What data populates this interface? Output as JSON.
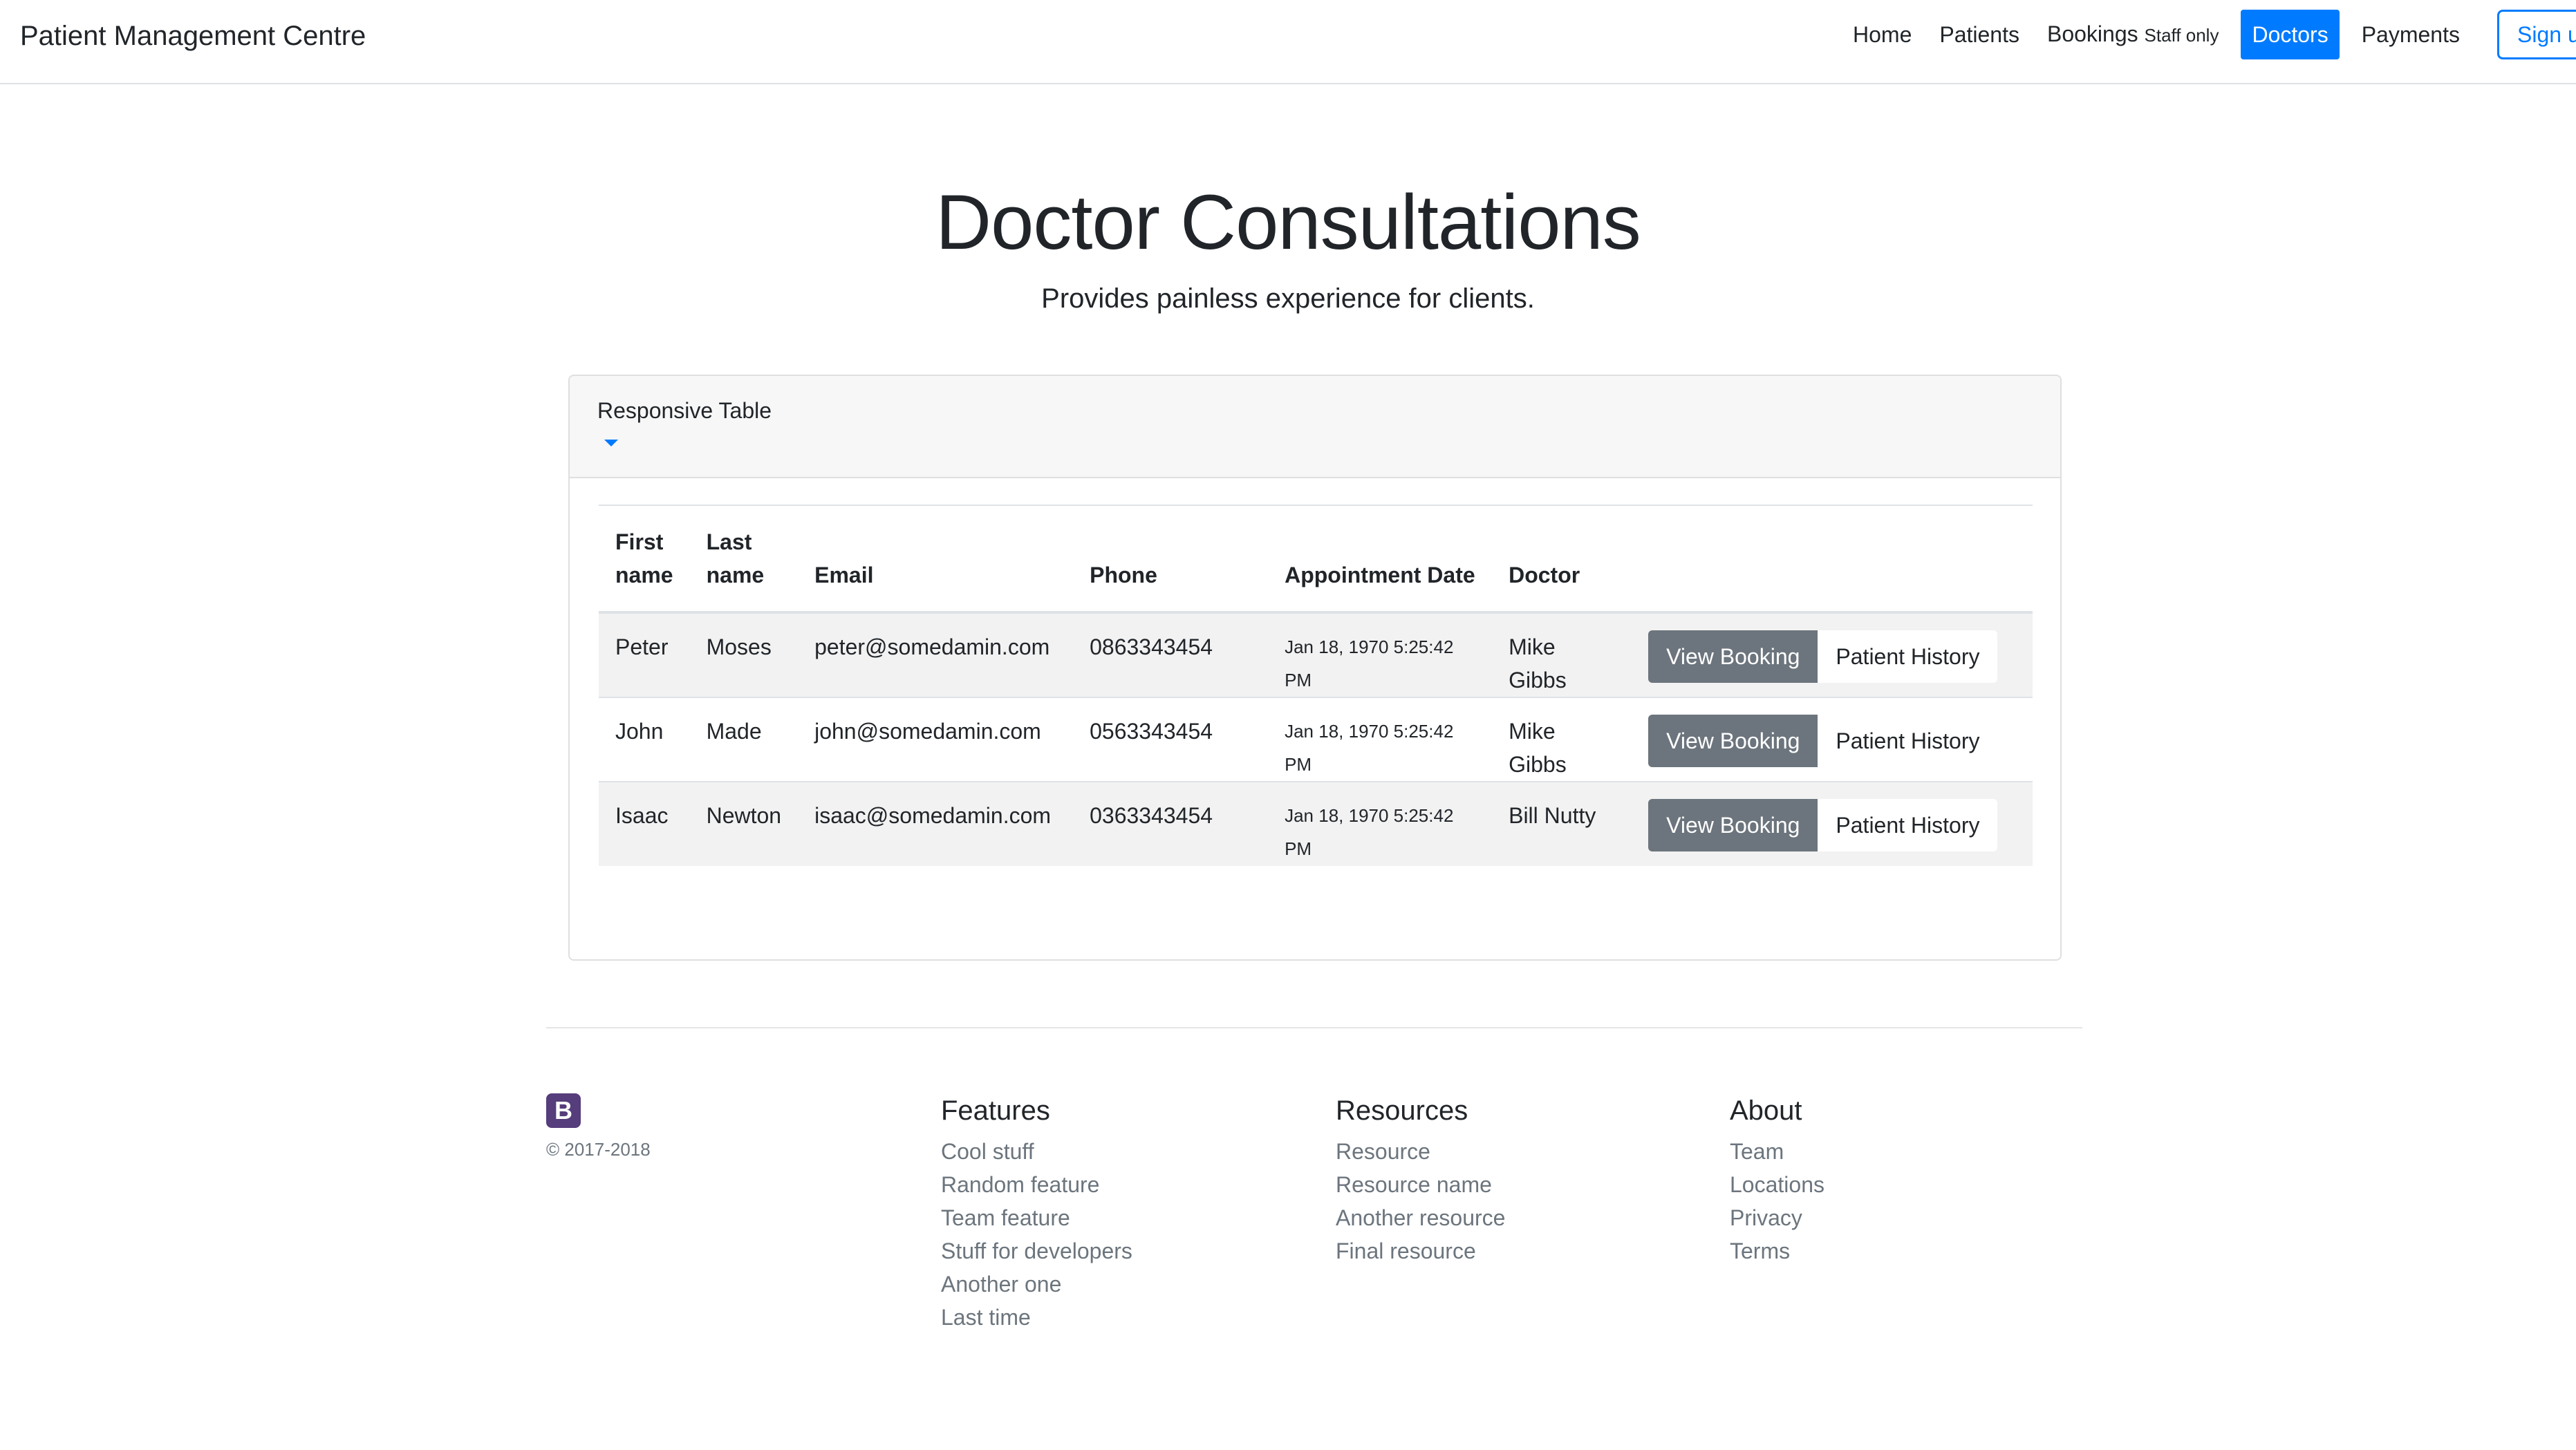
{
  "navbar": {
    "brand": "Patient Management Centre",
    "links": [
      {
        "label": "Home"
      },
      {
        "label": "Patients"
      },
      {
        "label": "Bookings",
        "note": "Staff only"
      },
      {
        "label": "Doctors",
        "active": true
      },
      {
        "label": "Payments"
      }
    ],
    "signup_label": "Sign u"
  },
  "hero": {
    "title": "Doctor Consultations",
    "subtitle": "Provides painless experience for clients."
  },
  "card": {
    "title": "Responsive Table",
    "caret_icon": "caret-down-icon"
  },
  "table": {
    "headers": {
      "first": "First name",
      "last": "Last name",
      "email": "Email",
      "phone": "Phone",
      "date": "Appointment Date",
      "doctor": "Doctor"
    },
    "rows": [
      {
        "first": "Peter",
        "last": "Moses",
        "email": "peter@somedamin.com",
        "phone": "0863343454",
        "date": "Jan 18, 1970 5:25:42 PM",
        "doctor": "Mike Gibbs",
        "view": "View Booking",
        "history": "Patient History"
      },
      {
        "first": "John",
        "last": "Made",
        "email": "john@somedamin.com",
        "phone": "0563343454",
        "date": "Jan 18, 1970 5:25:42 PM",
        "doctor": "Mike Gibbs",
        "view": "View Booking",
        "history": "Patient History"
      },
      {
        "first": "Isaac",
        "last": "Newton",
        "email": "isaac@somedamin.com",
        "phone": "0363343454",
        "date": "Jan 18, 1970 5:25:42 PM",
        "doctor": "Bill Nutty",
        "view": "View Booking",
        "history": "Patient History"
      }
    ]
  },
  "footer": {
    "logo_letter": "B",
    "copyright": "© 2017-2018",
    "features": {
      "title": "Features",
      "items": [
        "Cool stuff",
        "Random feature",
        "Team feature",
        "Stuff for developers",
        "Another one",
        "Last time"
      ]
    },
    "resources": {
      "title": "Resources",
      "items": [
        "Resource",
        "Resource name",
        "Another resource",
        "Final resource"
      ]
    },
    "about": {
      "title": "About",
      "items": [
        "Team",
        "Locations",
        "Privacy",
        "Terms"
      ]
    }
  },
  "colors": {
    "primary": "#007bff",
    "secondary_button": "#6c757d",
    "logo": "#563d7c",
    "stripe": "#f2f2f2"
  }
}
